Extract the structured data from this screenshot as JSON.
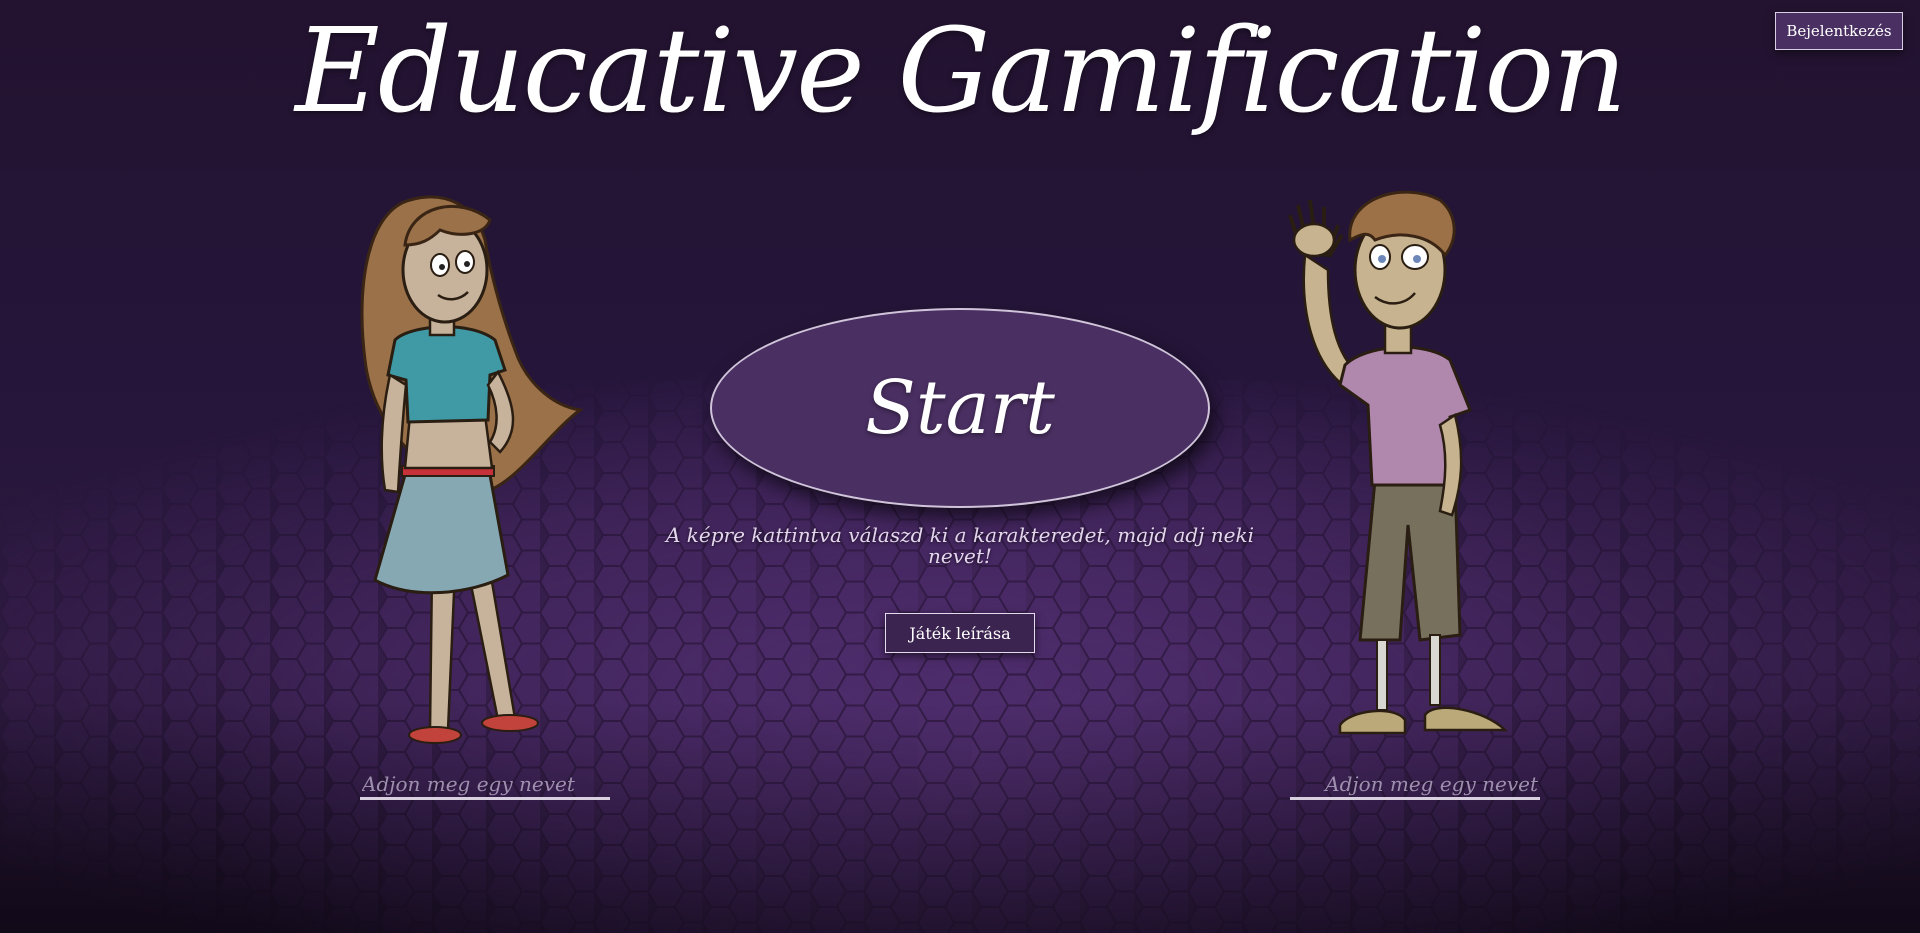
{
  "app": {
    "title": "Educative Gamification"
  },
  "header": {
    "login_label": "Bejelentkezés"
  },
  "main": {
    "start_label": "Start",
    "hint_text": "A képre kattintva válaszd ki a karakteredet, majd adj neki nevet!",
    "description_label": "Játék leírása"
  },
  "characters": {
    "left": {
      "name_placeholder": "Adjon meg egy nevet",
      "name_value": ""
    },
    "right": {
      "name_placeholder": "Adjon meg egy nevet",
      "name_value": ""
    }
  },
  "colors": {
    "background": "#22132f",
    "button_fill": "#4a2f62",
    "button_border": "#d9d0e4",
    "hex_floor": "#5a3580",
    "text": "#ffffff",
    "hint_text": "#e3d6ec"
  },
  "icons": {
    "characters": [
      "girl-character-icon",
      "boy-character-icon"
    ]
  }
}
